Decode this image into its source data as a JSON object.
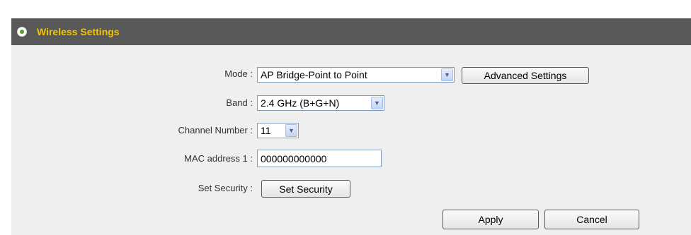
{
  "section": {
    "title": "Wireless Settings"
  },
  "form": {
    "mode_label": "Mode :",
    "mode_value": "AP Bridge-Point to Point",
    "advanced_label": "Advanced Settings",
    "band_label": "Band :",
    "band_value": "2.4 GHz (B+G+N)",
    "channel_label": "Channel Number :",
    "channel_value": "11",
    "mac_label": "MAC address 1 :",
    "mac_value": "000000000000",
    "security_label": "Set Security :",
    "security_button": "Set Security"
  },
  "actions": {
    "apply": "Apply",
    "cancel": "Cancel"
  },
  "colors": {
    "header_bg": "#585858",
    "header_title": "#f5c400",
    "panel_bg": "#efefef"
  },
  "icons": {
    "header": "radio-bullet-icon",
    "dropdown": "chevron-down-icon"
  }
}
